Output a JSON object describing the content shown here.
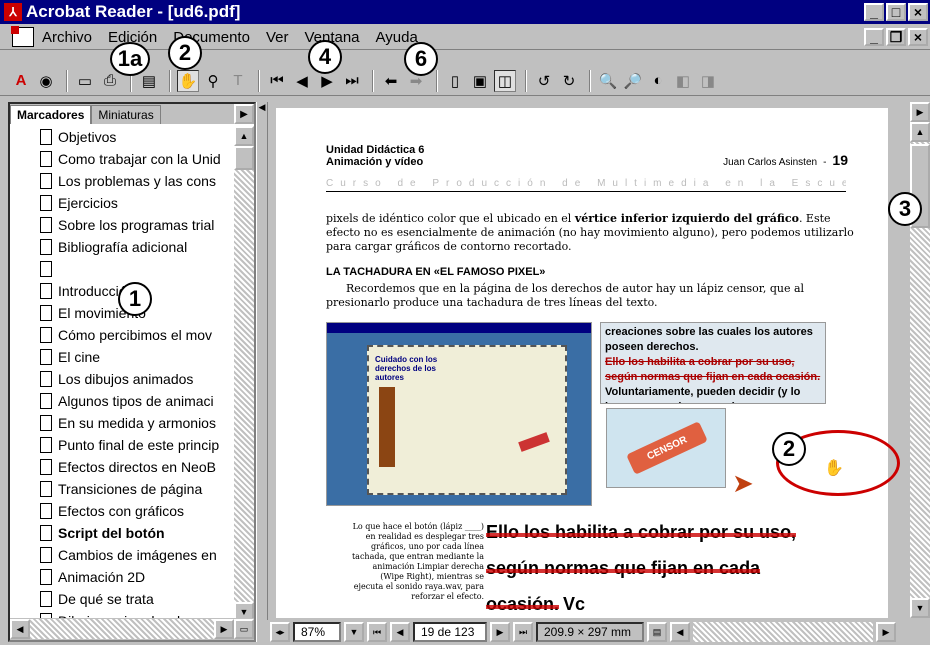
{
  "window": {
    "title": "Acrobat Reader - [ud6.pdf]",
    "app_icon": "acrobat-icon",
    "controls": [
      "_",
      "□",
      "×"
    ]
  },
  "menu": {
    "items": [
      "Archivo",
      "Edición",
      "Documento",
      "Ver",
      "Ventana",
      "Ayuda"
    ],
    "doc_controls": [
      "_",
      "❐",
      "×"
    ]
  },
  "callouts": {
    "c1a": "1a",
    "c2": "2",
    "c4": "4",
    "c6": "6",
    "c3": "3",
    "c1": "1",
    "c2b": "2"
  },
  "toolbar": {
    "icons": [
      "acrobat-logo-icon",
      "web-icon",
      "open-icon",
      "print-icon",
      "bookmarks-toggle-icon",
      "hand-icon",
      "zoom-icon",
      "text-select-icon",
      "first-page-icon",
      "prev-page-icon",
      "next-page-icon",
      "last-page-icon",
      "back-icon",
      "forward-icon",
      "actual-size-icon",
      "fit-page-icon",
      "fit-width-icon",
      "rotate-left-icon",
      "rotate-right-icon",
      "find-icon",
      "find-next-icon",
      "search-icon",
      "prev-highlight-icon",
      "next-highlight-icon"
    ]
  },
  "panel": {
    "tabs": [
      "Marcadores",
      "Miniaturas"
    ],
    "bookmarks": [
      {
        "label": "Objetivos",
        "bold": false
      },
      {
        "label": "Como trabajar con la Unid",
        "bold": false
      },
      {
        "label": "Los problemas y las cons",
        "bold": false
      },
      {
        "label": "Ejercicios",
        "bold": false
      },
      {
        "label": "Sobre los programas trial",
        "bold": false
      },
      {
        "label": "Bibliografía adicional",
        "bold": false
      },
      {
        "label": "",
        "bold": false
      },
      {
        "label": "Introducción",
        "bold": false
      },
      {
        "label": "El movimiento",
        "bold": false
      },
      {
        "label": "Cómo percibimos el mov",
        "bold": false
      },
      {
        "label": "El cine",
        "bold": false
      },
      {
        "label": "Los dibujos animados",
        "bold": false
      },
      {
        "label": "Algunos tipos de animaci",
        "bold": false
      },
      {
        "label": "En su medida y armonios",
        "bold": false
      },
      {
        "label": "Punto final de este princip",
        "bold": false
      },
      {
        "label": "Efectos directos en NeoB",
        "bold": false
      },
      {
        "label": "Transiciones de página",
        "bold": false
      },
      {
        "label": "Efectos con gráficos",
        "bold": false
      },
      {
        "label": "Script del botón",
        "bold": true
      },
      {
        "label": "Cambios de imágenes en",
        "bold": false
      },
      {
        "label": "Animación 2D",
        "bold": false
      },
      {
        "label": "De qué se trata",
        "bold": false
      },
      {
        "label": "Dibujos animados: los pr",
        "bold": false
      }
    ]
  },
  "page": {
    "unit": "Unidad Didáctica 6",
    "subtitle": "Animación y vídeo",
    "author": "Juan Carlos Asinsten",
    "sep": "-",
    "pagenum": "19",
    "course": "Curso de Producción de Multimedia en la Escuela",
    "para1_pre": "pixels de idéntico color que el ubicado en el ",
    "para1_bold": "vértice inferior izquierdo del gráfico",
    "para1_post": ". Este efecto no es esencialmente de animación (no hay movimiento alguno), pero podemos utilizarlo para cargar gráficos de contorno recortado.",
    "heading": "LA TACHADURA EN «EL FAMOSO PIXEL»",
    "para2": "Recordemos que en la página de los derechos de autor hay un lápiz censor, que al presionarlo produce una tachadura de tres líneas del texto.",
    "screenshot_title": "Cuidado con los derechos de los autores",
    "pencil_label": "CENSOR",
    "right_text1": "creaciones sobre las cuales los autores poseen derechos.",
    "right_text2": "Ello los habilita a cobrar por su uso, según normas que fijan en cada ocasión.",
    "right_text3": "Voluntariamente, pueden decidir (y lo hacen en muchos casos)",
    "caption": "Lo que hace el botón (lápiz ____) en realidad es desplegar tres gráficos, uno por cada línea tachada, que entran mediante la animación Limpiar derecha (Wipe Right), mientras se ejecuta el sonido raya.wav, para reforzar el efecto.",
    "strike1": "Ello los habilita a cobrar por su uso,",
    "strike2": "según normas que fijan en cada",
    "strike3": "ocasión.",
    "strike3_tail": "Vc"
  },
  "status": {
    "zoom": "87%",
    "page": "19 de 123",
    "size": "209.9 × 297 mm"
  }
}
